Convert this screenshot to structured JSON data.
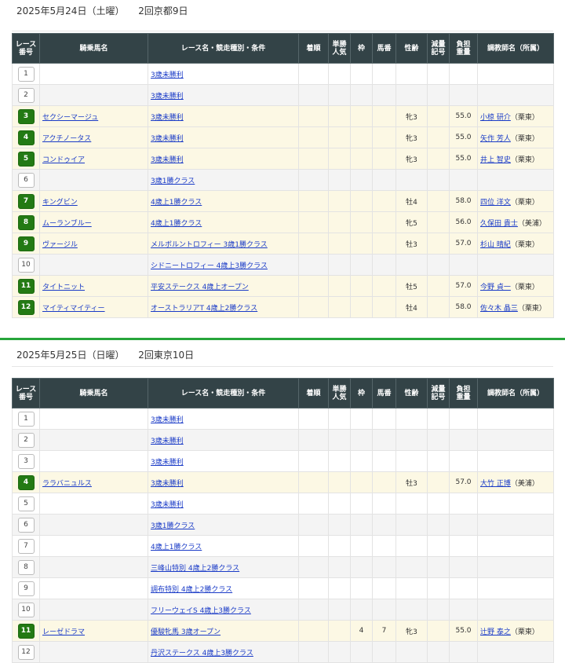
{
  "headers": [
    "レース\n番号",
    "騎乗馬名",
    "レース名・競走種別・条件",
    "着順",
    "単勝\n人気",
    "枠",
    "馬番",
    "性齢",
    "減量\n記号",
    "負担\n重量",
    "調教師名（所属）"
  ],
  "days": [
    {
      "date": "2025年5月24日（土曜）",
      "venue": "2回京都9日",
      "rows": [
        {
          "no": "1",
          "horse": "",
          "race": "3歳未勝利",
          "rank": "",
          "pop": "",
          "waku": "",
          "umaban": "",
          "sex": "",
          "gen": "",
          "wt": "",
          "trainer": "",
          "aff": ""
        },
        {
          "no": "2",
          "horse": "",
          "race": "3歳未勝利",
          "rank": "",
          "pop": "",
          "waku": "",
          "umaban": "",
          "sex": "",
          "gen": "",
          "wt": "",
          "trainer": "",
          "aff": ""
        },
        {
          "no": "3",
          "horse": "セクシーマージュ",
          "race": "3歳未勝利",
          "rank": "",
          "pop": "",
          "waku": "",
          "umaban": "",
          "sex": "牝3",
          "gen": "",
          "wt": "55.0",
          "trainer": "小椋 研介",
          "aff": "（栗東）"
        },
        {
          "no": "4",
          "horse": "アクチノータス",
          "race": "3歳未勝利",
          "rank": "",
          "pop": "",
          "waku": "",
          "umaban": "",
          "sex": "牝3",
          "gen": "",
          "wt": "55.0",
          "trainer": "矢作 芳人",
          "aff": "（栗東）"
        },
        {
          "no": "5",
          "horse": "コンドゥイア",
          "race": "3歳未勝利",
          "rank": "",
          "pop": "",
          "waku": "",
          "umaban": "",
          "sex": "牝3",
          "gen": "",
          "wt": "55.0",
          "trainer": "井上 智史",
          "aff": "（栗東）"
        },
        {
          "no": "6",
          "horse": "",
          "race": "3歳1勝クラス",
          "rank": "",
          "pop": "",
          "waku": "",
          "umaban": "",
          "sex": "",
          "gen": "",
          "wt": "",
          "trainer": "",
          "aff": ""
        },
        {
          "no": "7",
          "horse": "キングビン",
          "race": "4歳上1勝クラス",
          "rank": "",
          "pop": "",
          "waku": "",
          "umaban": "",
          "sex": "牡4",
          "gen": "",
          "wt": "58.0",
          "trainer": "四位 洋文",
          "aff": "（栗東）"
        },
        {
          "no": "8",
          "horse": "ムーランブルー",
          "race": "4歳上1勝クラス",
          "rank": "",
          "pop": "",
          "waku": "",
          "umaban": "",
          "sex": "牝5",
          "gen": "",
          "wt": "56.0",
          "trainer": "久保田 貴士",
          "aff": "（美浦）"
        },
        {
          "no": "9",
          "horse": "ヴァージル",
          "race": "メルボルントロフィー 3歳1勝クラス",
          "rank": "",
          "pop": "",
          "waku": "",
          "umaban": "",
          "sex": "牡3",
          "gen": "",
          "wt": "57.0",
          "trainer": "杉山 晴紀",
          "aff": "（栗東）"
        },
        {
          "no": "10",
          "horse": "",
          "race": "シドニートロフィー 4歳上3勝クラス",
          "rank": "",
          "pop": "",
          "waku": "",
          "umaban": "",
          "sex": "",
          "gen": "",
          "wt": "",
          "trainer": "",
          "aff": ""
        },
        {
          "no": "11",
          "horse": "タイトニット",
          "race": "平安ステークス 4歳上オープン",
          "rank": "",
          "pop": "",
          "waku": "",
          "umaban": "",
          "sex": "牡5",
          "gen": "",
          "wt": "57.0",
          "trainer": "今野 貞一",
          "aff": "（栗東）"
        },
        {
          "no": "12",
          "horse": "マイティマイティー",
          "race": "オーストラリアT 4歳上2勝クラス",
          "rank": "",
          "pop": "",
          "waku": "",
          "umaban": "",
          "sex": "牡4",
          "gen": "",
          "wt": "58.0",
          "trainer": "佐々木 晶三",
          "aff": "（栗東）"
        }
      ]
    },
    {
      "date": "2025年5月25日（日曜）",
      "venue": "2回東京10日",
      "rows": [
        {
          "no": "1",
          "horse": "",
          "race": "3歳未勝利",
          "rank": "",
          "pop": "",
          "waku": "",
          "umaban": "",
          "sex": "",
          "gen": "",
          "wt": "",
          "trainer": "",
          "aff": ""
        },
        {
          "no": "2",
          "horse": "",
          "race": "3歳未勝利",
          "rank": "",
          "pop": "",
          "waku": "",
          "umaban": "",
          "sex": "",
          "gen": "",
          "wt": "",
          "trainer": "",
          "aff": ""
        },
        {
          "no": "3",
          "horse": "",
          "race": "3歳未勝利",
          "rank": "",
          "pop": "",
          "waku": "",
          "umaban": "",
          "sex": "",
          "gen": "",
          "wt": "",
          "trainer": "",
          "aff": ""
        },
        {
          "no": "4",
          "horse": "ララバニュルス",
          "race": "3歳未勝利",
          "rank": "",
          "pop": "",
          "waku": "",
          "umaban": "",
          "sex": "牡3",
          "gen": "",
          "wt": "57.0",
          "trainer": "大竹 正博",
          "aff": "（美浦）"
        },
        {
          "no": "5",
          "horse": "",
          "race": "3歳未勝利",
          "rank": "",
          "pop": "",
          "waku": "",
          "umaban": "",
          "sex": "",
          "gen": "",
          "wt": "",
          "trainer": "",
          "aff": ""
        },
        {
          "no": "6",
          "horse": "",
          "race": "3歳1勝クラス",
          "rank": "",
          "pop": "",
          "waku": "",
          "umaban": "",
          "sex": "",
          "gen": "",
          "wt": "",
          "trainer": "",
          "aff": ""
        },
        {
          "no": "7",
          "horse": "",
          "race": "4歳上1勝クラス",
          "rank": "",
          "pop": "",
          "waku": "",
          "umaban": "",
          "sex": "",
          "gen": "",
          "wt": "",
          "trainer": "",
          "aff": ""
        },
        {
          "no": "8",
          "horse": "",
          "race": "三峰山特別 4歳上2勝クラス",
          "rank": "",
          "pop": "",
          "waku": "",
          "umaban": "",
          "sex": "",
          "gen": "",
          "wt": "",
          "trainer": "",
          "aff": ""
        },
        {
          "no": "9",
          "horse": "",
          "race": "調布特別 4歳上2勝クラス",
          "rank": "",
          "pop": "",
          "waku": "",
          "umaban": "",
          "sex": "",
          "gen": "",
          "wt": "",
          "trainer": "",
          "aff": ""
        },
        {
          "no": "10",
          "horse": "",
          "race": "フリーウェイS 4歳上3勝クラス",
          "rank": "",
          "pop": "",
          "waku": "",
          "umaban": "",
          "sex": "",
          "gen": "",
          "wt": "",
          "trainer": "",
          "aff": ""
        },
        {
          "no": "11",
          "horse": "レーゼドラマ",
          "race": "優駿牝馬 3歳オープン",
          "rank": "",
          "pop": "",
          "waku": "4",
          "umaban": "7",
          "sex": "牝3",
          "gen": "",
          "wt": "55.0",
          "trainer": "辻野 泰之",
          "aff": "（栗東）"
        },
        {
          "no": "12",
          "horse": "",
          "race": "丹沢ステークス 4歳上3勝クラス",
          "rank": "",
          "pop": "",
          "waku": "",
          "umaban": "",
          "sex": "",
          "gen": "",
          "wt": "",
          "trainer": "",
          "aff": ""
        }
      ]
    }
  ]
}
